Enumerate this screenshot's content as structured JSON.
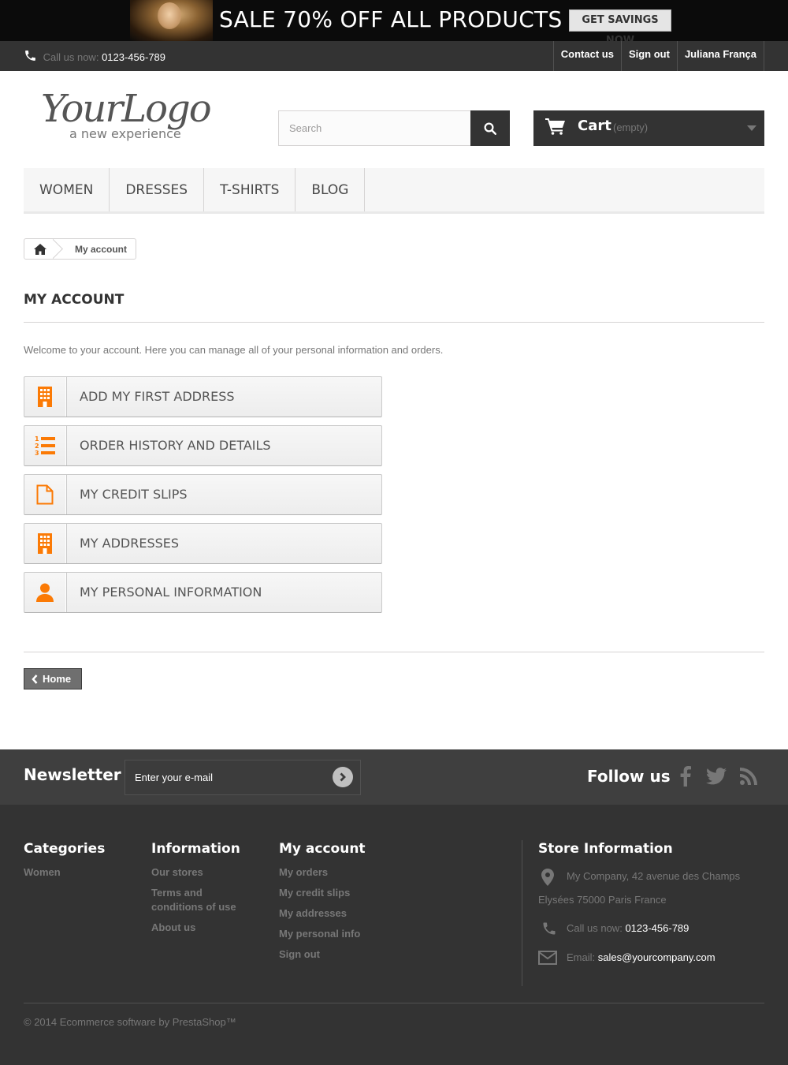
{
  "banner": {
    "text": "SALE 70% OFF ALL PRODUCTS",
    "button": "GET SAVINGS NOW"
  },
  "topnav": {
    "call_label": "Call us now:",
    "phone": "0123-456-789",
    "links": [
      "Contact us",
      "Sign out",
      "Juliana França"
    ]
  },
  "logo": {
    "main": "YourLogo",
    "tagline": "a new experience"
  },
  "search": {
    "placeholder": "Search"
  },
  "cart": {
    "label": "Cart",
    "status": "(empty)"
  },
  "menu": [
    "Women",
    "Dresses",
    "T-shirts",
    "Blog"
  ],
  "breadcrumb": {
    "current": "My account"
  },
  "page": {
    "heading": "My account",
    "welcome": "Welcome to your account. Here you can manage all of your personal information and orders."
  },
  "account_buttons": [
    {
      "label": "Add my first address",
      "icon": "building-icon"
    },
    {
      "label": "Order history and details",
      "icon": "numbered-list-icon"
    },
    {
      "label": "My credit slips",
      "icon": "document-icon"
    },
    {
      "label": "My addresses",
      "icon": "building-icon"
    },
    {
      "label": "My personal information",
      "icon": "user-icon"
    }
  ],
  "home_button": "Home",
  "newsletter": {
    "title": "Newsletter",
    "placeholder": "Enter your e-mail"
  },
  "follow": {
    "title": "Follow us"
  },
  "footer": {
    "categories": {
      "title": "Categories",
      "items": [
        "Women"
      ]
    },
    "information": {
      "title": "Information",
      "items": [
        "Our stores",
        "Terms and conditions of use",
        "About us"
      ]
    },
    "my_account": {
      "title": "My account",
      "items": [
        "My orders",
        "My credit slips",
        "My addresses",
        "My personal info",
        "Sign out"
      ]
    },
    "store": {
      "title": "Store Information",
      "address_line1": "My Company, 42 avenue des Champs",
      "address_line2": "Elysées 75000 Paris France",
      "call_label": "Call us now:",
      "phone": "0123-456-789",
      "email_label": "Email:",
      "email": "sales@yourcompany.com"
    },
    "copyright": "© 2014 Ecommerce software by PrestaShop™"
  },
  "colors": {
    "accent": "#f13340",
    "icon_orange": "#fb7a05",
    "dark": "#333333"
  }
}
